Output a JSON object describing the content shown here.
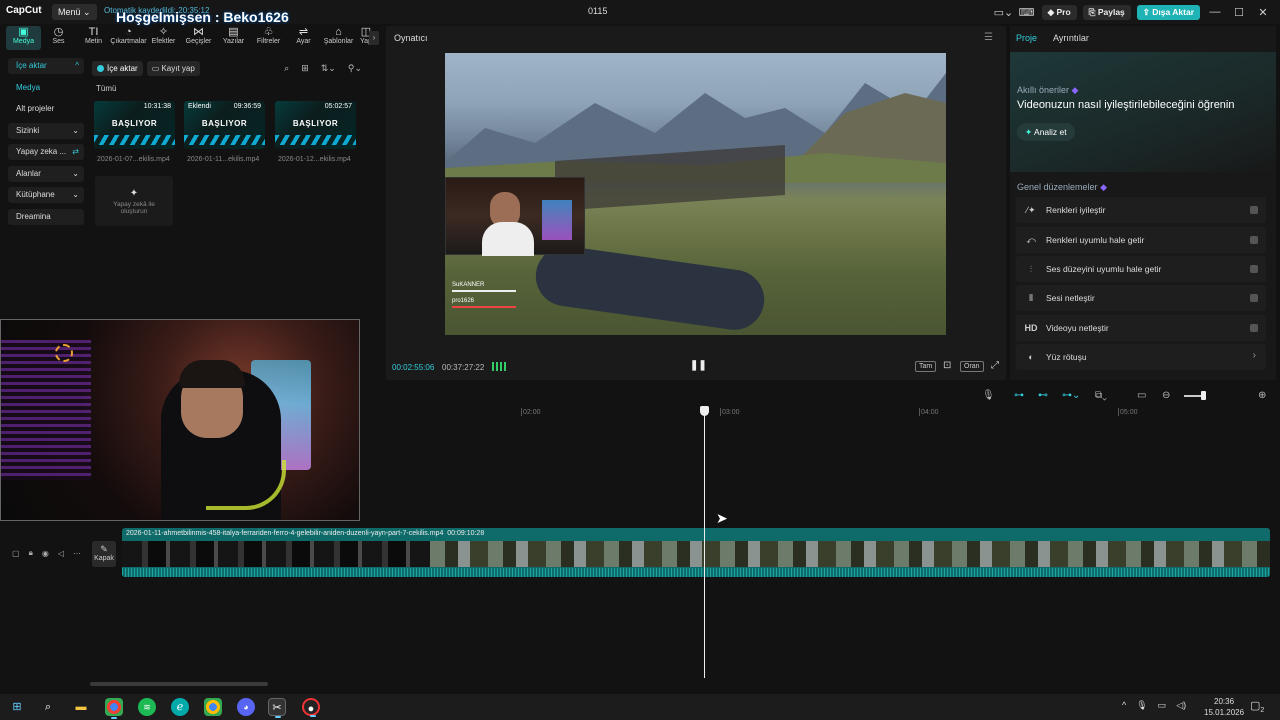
{
  "titlebar": {
    "logo": "CapCut",
    "menu": "Menü",
    "autosave": "Otomatik kaydedildi: 20:35:12",
    "overlay_name": "Hoşgelmişsen : Beko1626",
    "project_name": "0115",
    "pro": "Pro",
    "share": "Paylaş",
    "export": "Dışa Aktar"
  },
  "toolbar": [
    {
      "label": "Medya",
      "icon": "media-icon"
    },
    {
      "label": "Ses",
      "icon": "audio-icon"
    },
    {
      "label": "Metin",
      "icon": "text-icon"
    },
    {
      "label": "Çıkartmalar",
      "icon": "sticker-icon"
    },
    {
      "label": "Efektler",
      "icon": "effects-icon"
    },
    {
      "label": "Geçişler",
      "icon": "transition-icon"
    },
    {
      "label": "Yazılar",
      "icon": "captions-icon"
    },
    {
      "label": "Filtreler",
      "icon": "filter-icon"
    },
    {
      "label": "Ayar",
      "icon": "adjust-icon"
    },
    {
      "label": "Şablonlar",
      "icon": "template-icon"
    },
    {
      "label": "Yap",
      "icon": "more-icon"
    }
  ],
  "sidenav": [
    {
      "label": "İçe aktar",
      "chev": "^"
    },
    {
      "label": "Medya",
      "chev": ""
    },
    {
      "label": "Alt projeler",
      "chev": ""
    },
    {
      "label": "Sizinki",
      "chev": "⌄"
    },
    {
      "label": "Yapay zeka ...",
      "chev": "⇄"
    },
    {
      "label": "Alanlar",
      "chev": "⌄"
    },
    {
      "label": "Kütüphane",
      "chev": "⌄"
    },
    {
      "label": "Dreamina",
      "chev": ""
    }
  ],
  "media": {
    "import_btn": "İçe aktar",
    "record_btn": "Kayıt yap",
    "filter_label": "Tümü",
    "items": [
      {
        "title": "BAŞLIYOR",
        "duration": "10:31:38",
        "badge": "",
        "name": "2026-01-07...ekilis.mp4"
      },
      {
        "title": "BAŞLIYOR",
        "duration": "09:36:59",
        "badge": "Eklendi",
        "name": "2026-01-11...ekilis.mp4"
      },
      {
        "title": "BAŞLIYOR",
        "duration": "05:02:57",
        "badge": "",
        "name": "2026-01-12...ekilis.mp4"
      }
    ],
    "ai_create": "Yapay zekâ ile oluşturun"
  },
  "player": {
    "title": "Oynatıcı",
    "current_time": "00:02:55:06",
    "total_time": "00:37:27:22",
    "ctl_full": "Tam",
    "ctl_ratio": "Oran",
    "hud_name1": "SuKANNER",
    "hud_name2": "pro1626"
  },
  "right_panel": {
    "tab_project": "Proje",
    "tab_details": "Ayrıntılar",
    "smart_subtitle": "Akıllı öneriler",
    "smart_title": "Videonuzun nasıl iyileştirilebileceğini öğrenin",
    "analyze": "Analiz et",
    "general_title": "Genel düzenlemeler",
    "options": [
      {
        "label": "Renkleri iyileştir",
        "icon": "wand-icon"
      },
      {
        "label": "Renkleri uyumlu hale getir",
        "icon": "color-match-icon"
      },
      {
        "label": "Ses düzeyini uyumlu hale getir",
        "icon": "volume-sliders-icon"
      },
      {
        "label": "Sesi netleştir",
        "icon": "waveform-icon"
      },
      {
        "label": "Videoyu netleştir",
        "icon": "hd-icon"
      },
      {
        "label": "Yüz rötuşu",
        "icon": "face-retouch-icon"
      }
    ]
  },
  "timeline": {
    "ruler": [
      "02:00",
      "03:00",
      "04:00",
      "05:00"
    ],
    "cover": "Kapak",
    "clip_name": "2026-01-11-ahmetbilinmis-458-italya-ferrariden-ferro-4-gelebilir-aniden-duzenli-yayn-part-7-cekilis.mp4",
    "clip_duration": "00:09:10:28",
    "progress_fraction": 0.078
  },
  "taskbar": {
    "time": "20:36",
    "date": "15.01.2026",
    "notifications": "2"
  }
}
